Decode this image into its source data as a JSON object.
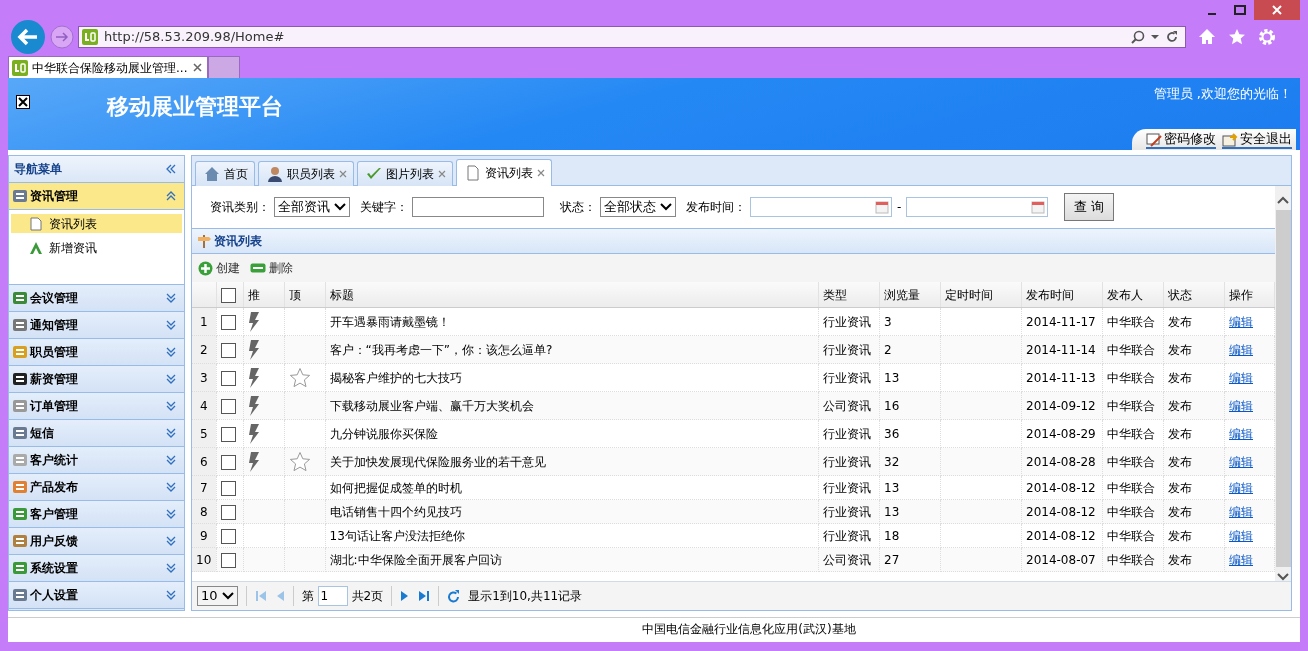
{
  "browser": {
    "url": "http://58.53.209.98/Home#",
    "tab_title": "中华联合保险移动展业管理..."
  },
  "header": {
    "title": "移动展业管理平台",
    "welcome": "管理员 ,欢迎您的光临！",
    "links": [
      "密码修改",
      "安全退出"
    ]
  },
  "sidebar": {
    "title": "导航菜单",
    "sections": [
      {
        "label": "资讯管理",
        "expanded": true,
        "items": [
          {
            "label": "资讯列表",
            "selected": true
          },
          {
            "label": "新增资讯",
            "selected": false
          }
        ]
      },
      {
        "label": "会议管理",
        "expanded": false
      },
      {
        "label": "通知管理",
        "expanded": false
      },
      {
        "label": "职员管理",
        "expanded": false
      },
      {
        "label": "薪资管理",
        "expanded": false
      },
      {
        "label": "订单管理",
        "expanded": false
      },
      {
        "label": "短信",
        "expanded": false
      },
      {
        "label": "客户统计",
        "expanded": false
      },
      {
        "label": "产品发布",
        "expanded": false
      },
      {
        "label": "客户管理",
        "expanded": false
      },
      {
        "label": "用户反馈",
        "expanded": false
      },
      {
        "label": "系统设置",
        "expanded": false
      },
      {
        "label": "个人设置",
        "expanded": false
      }
    ]
  },
  "tabs": [
    {
      "label": "首页",
      "selected": false,
      "closable": false
    },
    {
      "label": "职员列表",
      "selected": false,
      "closable": true
    },
    {
      "label": "图片列表",
      "selected": false,
      "closable": true
    },
    {
      "label": "资讯列表",
      "selected": true,
      "closable": true
    }
  ],
  "filters": {
    "category_label": "资讯类别：",
    "category_value": "全部资讯",
    "keyword_label": "关键字：",
    "status_label": "状态：",
    "status_value": "全部状态",
    "date_label": "发布时间：",
    "date_separator": "-",
    "query_button": "查 询"
  },
  "panel": {
    "title": "资讯列表",
    "actions": [
      {
        "label": "创建",
        "kind": "add"
      },
      {
        "label": "删除",
        "kind": "remove"
      }
    ]
  },
  "table": {
    "columns": [
      "推",
      "顶",
      "标题",
      "类型",
      "浏览量",
      "定时时间",
      "发布时间",
      "发布人",
      "状态",
      "操作"
    ],
    "all_checked": false,
    "rows": [
      {
        "no": "1",
        "checked": false,
        "pushed": true,
        "top": false,
        "title": "开车遇暴雨请戴墨镜！",
        "type": "行业资讯",
        "views": "3",
        "date": "2014-11-17",
        "publisher": "中华联合",
        "status": "发布",
        "action": "编辑"
      },
      {
        "no": "2",
        "checked": false,
        "pushed": true,
        "top": false,
        "title": "客户：“我再考虑一下”，你：该怎么逼单?",
        "type": "行业资讯",
        "views": "2",
        "date": "2014-11-14",
        "publisher": "中华联合",
        "status": "发布",
        "action": "编辑"
      },
      {
        "no": "3",
        "checked": false,
        "pushed": true,
        "top": true,
        "title": "揭秘客户维护的七大技巧",
        "type": "行业资讯",
        "views": "13",
        "date": "2014-11-13",
        "publisher": "中华联合",
        "status": "发布",
        "action": "编辑"
      },
      {
        "no": "4",
        "checked": false,
        "pushed": true,
        "top": false,
        "title": "下载移动展业客户端、赢千万大奖机会",
        "type": "公司资讯",
        "views": "16",
        "date": "2014-09-12",
        "publisher": "中华联合",
        "status": "发布",
        "action": "编辑"
      },
      {
        "no": "5",
        "checked": false,
        "pushed": true,
        "top": false,
        "title": "九分钟说服你买保险",
        "type": "行业资讯",
        "views": "36",
        "date": "2014-08-29",
        "publisher": "中华联合",
        "status": "发布",
        "action": "编辑"
      },
      {
        "no": "6",
        "checked": false,
        "pushed": true,
        "top": true,
        "title": "关于加快发展现代保险服务业的若干意见",
        "type": "行业资讯",
        "views": "32",
        "date": "2014-08-28",
        "publisher": "中华联合",
        "status": "发布",
        "action": "编辑"
      },
      {
        "no": "7",
        "checked": false,
        "pushed": false,
        "top": false,
        "title": "如何把握促成签单的时机",
        "type": "行业资讯",
        "views": "13",
        "date": "2014-08-12",
        "publisher": "中华联合",
        "status": "发布",
        "action": "编辑"
      },
      {
        "no": "8",
        "checked": false,
        "pushed": false,
        "top": false,
        "title": "电话销售十四个约见技巧",
        "type": "行业资讯",
        "views": "13",
        "date": "2014-08-12",
        "publisher": "中华联合",
        "status": "发布",
        "action": "编辑"
      },
      {
        "no": "9",
        "checked": false,
        "pushed": false,
        "top": false,
        "title": "13句话让客户没法拒绝你",
        "type": "行业资讯",
        "views": "18",
        "date": "2014-08-12",
        "publisher": "中华联合",
        "status": "发布",
        "action": "编辑"
      },
      {
        "no": "10",
        "checked": false,
        "pushed": false,
        "top": false,
        "title": "湖北:中华保险全面开展客户回访",
        "type": "公司资讯",
        "views": "27",
        "date": "2014-08-07",
        "publisher": "中华联合",
        "status": "发布",
        "action": "编辑"
      }
    ]
  },
  "pager": {
    "page_size": "10",
    "page_prefix": "第",
    "page": "1",
    "page_total": "共2页",
    "info": "显示1到10,共11记录"
  },
  "footer": "中国电信金融行业信息化应用(武汉)基地"
}
